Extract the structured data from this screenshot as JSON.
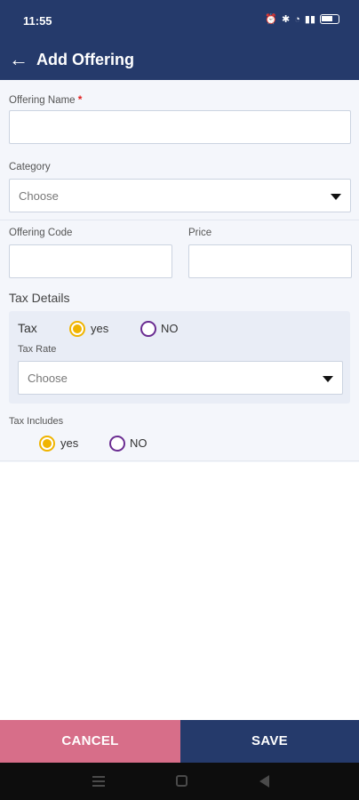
{
  "status_bar": {
    "time": "11:55"
  },
  "app_bar": {
    "title": "Add Offering"
  },
  "form": {
    "offering_name": {
      "label": "Offering Name",
      "required_mark": "*",
      "value": ""
    },
    "category": {
      "label": "Category",
      "selected": "Choose"
    },
    "offering_code": {
      "label": "Offering Code",
      "value": ""
    },
    "price": {
      "label": "Price",
      "value": ""
    },
    "tax_details": {
      "title": "Tax Details",
      "tax": {
        "label": "Tax",
        "options": [
          "yes",
          "NO"
        ],
        "selected": "yes"
      },
      "tax_rate": {
        "label": "Tax Rate",
        "selected": "Choose"
      }
    },
    "tax_includes": {
      "label": "Tax Includes",
      "options": [
        "yes",
        "NO"
      ],
      "selected": "yes"
    }
  },
  "actions": {
    "cancel_label": "CANCEL",
    "save_label": "SAVE"
  },
  "colors": {
    "primary": "#253a6b",
    "cancel": "#d76e89",
    "radio_selected": "#f0b400",
    "radio_unselected": "#6a2c91",
    "required": "#e02020"
  }
}
